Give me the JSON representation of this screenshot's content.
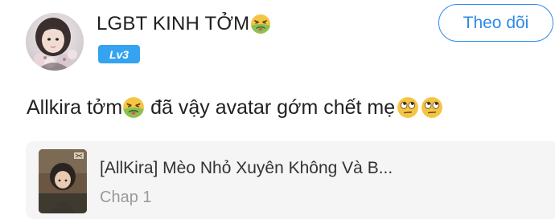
{
  "post": {
    "user": {
      "display_name": "LGBT KINH TỞM",
      "name_emoji": "nauseated-face-icon",
      "level": "Lv3"
    },
    "follow_button_label": "Theo dõi",
    "comment": {
      "part_before_emoji": "Allkira tởm",
      "part_after_emoji": " đã vậy avatar gớm chết mẹ",
      "emojis": [
        "nauseated-face-icon",
        "face-with-rolling-eyes-icon",
        "face-with-rolling-eyes-icon"
      ]
    },
    "linked_story": {
      "title": "[AllKira] Mèo Nhỏ Xuyên Không Và B...",
      "chapter": "Chap 1"
    }
  },
  "colors": {
    "accent_blue": "#2d8be8",
    "level_badge_bg": "#35a3f0",
    "card_bg": "#f5f5f5",
    "muted_text": "#9a9a9a"
  }
}
